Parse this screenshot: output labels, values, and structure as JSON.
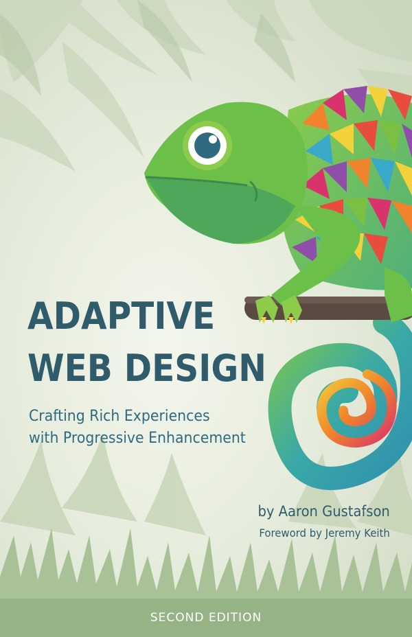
{
  "book": {
    "title_line_1": "ADAPTIVE",
    "title_line_2": "WEB DESIGN",
    "subtitle_line_1": "Crafting Rich Experiences",
    "subtitle_line_2": "with Progressive Enhancement",
    "author": "by Aaron Gustafson",
    "foreword": "Foreword by Jeremy Keith",
    "edition": "SECOND EDITION"
  },
  "colors": {
    "title": "#2f5b6b",
    "subtitle": "#2f6a80",
    "background": "#e6ecdc",
    "foliage": "#a9c29a",
    "chameleon_green": "#7bc043",
    "branch": "#5b4a42"
  },
  "illustration": {
    "subject": "chameleon-on-branch",
    "background": "jungle-foliage"
  }
}
